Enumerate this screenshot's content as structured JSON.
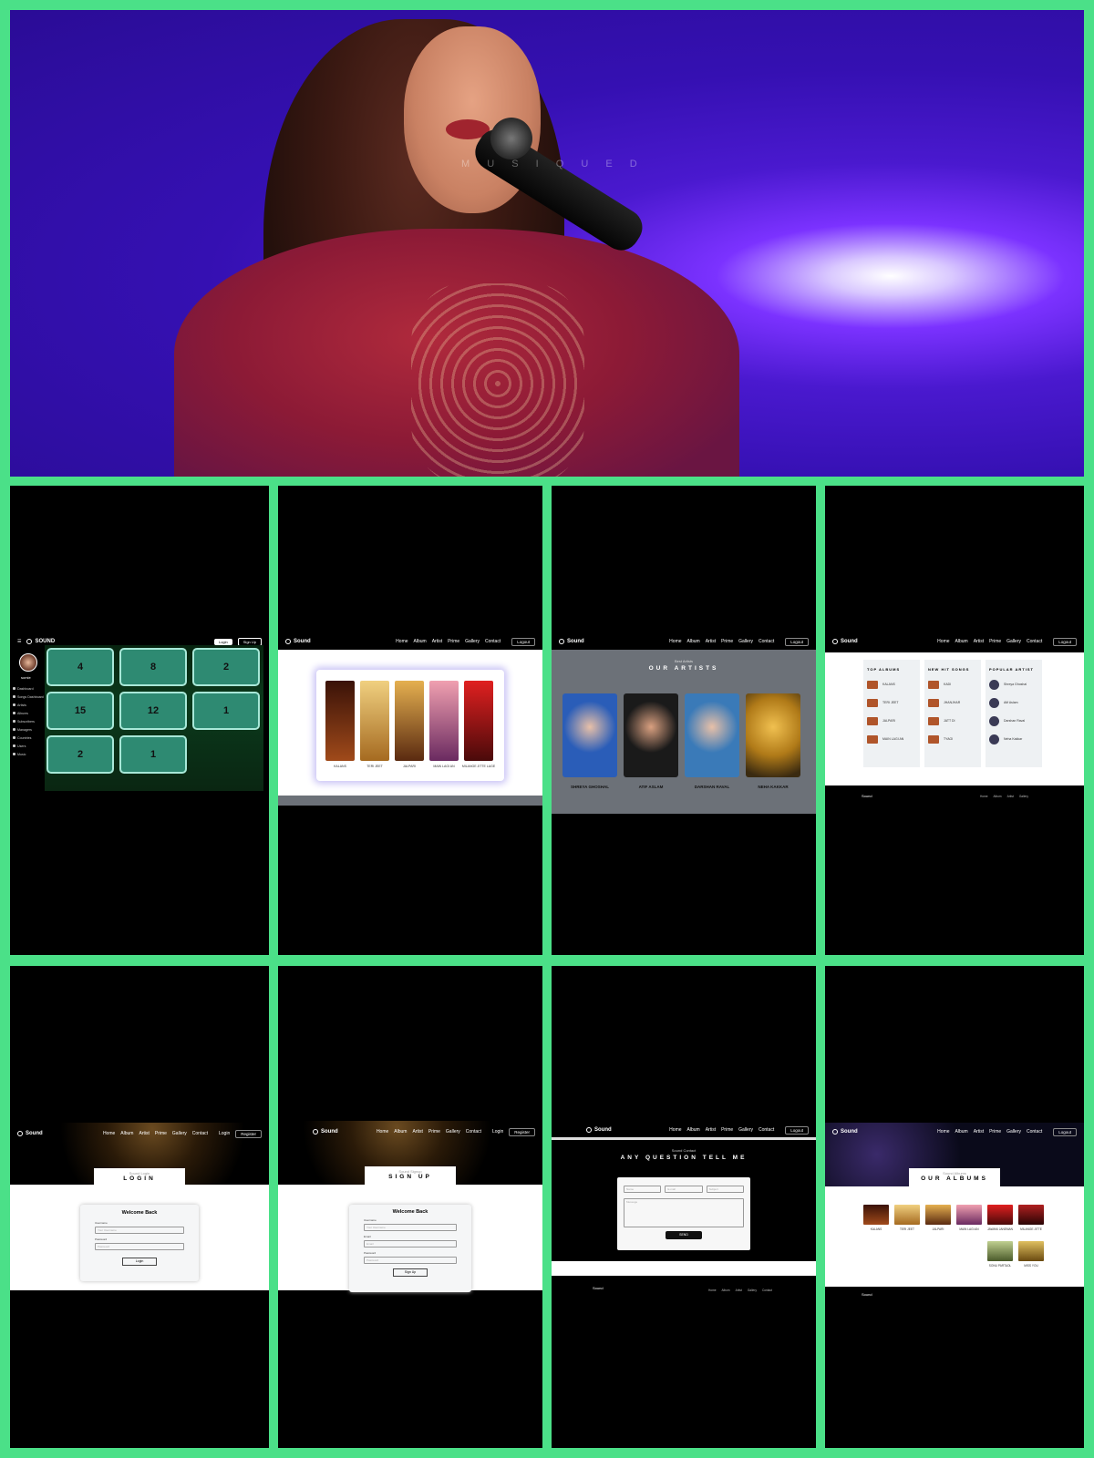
{
  "hero": {
    "watermark": "M U S I Q U E D"
  },
  "panel_dashboard": {
    "brand": "SOUND",
    "btn_login": "Login",
    "btn_signup": "Sign Up",
    "username": "somie",
    "sidebar": [
      "Dashboard",
      "Songs Dashboard",
      "Artists",
      "Albums",
      "Subscribers",
      "Managers",
      "Countries",
      "Users",
      "Music"
    ],
    "tiles": [
      "4",
      "8",
      "2",
      "15",
      "12",
      "1",
      "2",
      "1"
    ]
  },
  "panel_posters": {
    "brand": "Sound",
    "nav": [
      "Home",
      "Album",
      "Artist",
      "Prime",
      "Gallery",
      "Contact"
    ],
    "login": "Logout",
    "posters": [
      {
        "cap": "KALANS",
        "color": "#7a2a12"
      },
      {
        "cap": "TERI JEET",
        "color": "#c98a3a"
      },
      {
        "cap": "JALPARI",
        "color": "#c78a2a"
      },
      {
        "cap": "MAIN LAGI AN",
        "color": "#c94a70"
      },
      {
        "cap": "MILANGE JITTE LAGE",
        "color": "#b01d22"
      }
    ]
  },
  "panel_artists": {
    "brand": "Sound",
    "nav": [
      "Home",
      "Album",
      "Artist",
      "Prime",
      "Gallery",
      "Contact"
    ],
    "login": "Logout",
    "subtitle": "Best Artists",
    "title": "OUR ARTISTS",
    "artists": [
      {
        "name": "SHREYA GHOSHAL",
        "color": "#2a5db8"
      },
      {
        "name": "ATIF ASLAM",
        "color": "#1a1a1a"
      },
      {
        "name": "DARSHAN RAVAL",
        "color": "#3a7ab8"
      },
      {
        "name": "NEHA KAKKAR",
        "color": "#b07a18"
      }
    ]
  },
  "panel_top": {
    "brand": "Sound",
    "nav": [
      "Home",
      "Album",
      "Artist",
      "Prime",
      "Gallery",
      "Contact"
    ],
    "login": "Logout",
    "col1_title": "TOP ALBUMS",
    "col2_title": "NEW HIT SONGS",
    "col3_title": "POPULAR ARTIST",
    "albums": [
      "KALANS",
      "TERI JEET",
      "JALPARI",
      "MAIN LAGI AN"
    ],
    "songs": [
      "KADI",
      "JHANJHAR",
      "JATT DI",
      "TYAGI"
    ],
    "artists": [
      "Shreya Ghoshal",
      "Atif Aslam",
      "Darshan Raval",
      "Neha Kakkar"
    ],
    "footer_links": [
      "Home",
      "Album",
      "Artist",
      "Gallery"
    ]
  },
  "panel_login": {
    "brand": "Sound",
    "nav": [
      "Home",
      "Album",
      "Artist",
      "Prime",
      "Gallery",
      "Contact"
    ],
    "btn_login": "Login",
    "btn_register": "Register",
    "tag": "Sound Login",
    "title": "LOGIN",
    "heading": "Welcome Back",
    "label_user": "Username",
    "label_pass": "Password",
    "ph_user": "Your Username",
    "ph_pass": "Password",
    "submit": "Login"
  },
  "panel_signup": {
    "brand": "Sound",
    "nav": [
      "Home",
      "Album",
      "Artist",
      "Prime",
      "Gallery",
      "Contact"
    ],
    "btn_login": "Login",
    "btn_register": "Register",
    "tag": "Sound Signup",
    "title": "SIGN UP",
    "heading": "Welcome Back",
    "label_user": "Username",
    "label_email": "Email",
    "label_pass": "Password",
    "ph_user": "Your Username",
    "ph_email": "Email",
    "ph_pass": "Password",
    "submit": "Sign Up"
  },
  "panel_contact": {
    "brand": "Sound",
    "nav": [
      "Home",
      "Album",
      "Artist",
      "Prime",
      "Gallery",
      "Contact"
    ],
    "login": "Logout",
    "tag": "Sound Contact",
    "title": "ANY QUESTION TELL ME",
    "ph_name": "Name",
    "ph_email": "E-mail",
    "ph_subject": "Subject",
    "ph_message": "Message",
    "submit": "SEND",
    "footer_links": [
      "Home",
      "Album",
      "Artist",
      "Gallery",
      "Contact"
    ]
  },
  "panel_albums": {
    "brand": "Sound",
    "nav": [
      "Home",
      "Album",
      "Artist",
      "Prime",
      "Gallery",
      "Contact"
    ],
    "login": "Logout",
    "tag": "Sound Albums",
    "title": "OUR ALBUMS",
    "albums": [
      {
        "cap": "KALANS",
        "color": "#7a2a12"
      },
      {
        "cap": "TERI JEET",
        "color": "#c98a3a"
      },
      {
        "cap": "JALPARI",
        "color": "#c78a2a"
      },
      {
        "cap": "MAIN LAGI AN",
        "color": "#c94a70"
      },
      {
        "cap": "JAWANI JANEMAN",
        "color": "#b01d22"
      },
      {
        "cap": "MILANGE JITTE",
        "color": "#9a1a1a"
      },
      {
        "cap": "SONU PARTAOL",
        "color": "#8a9a4a"
      },
      {
        "cap": "MISS YOU",
        "color": "#b0882a"
      }
    ]
  }
}
